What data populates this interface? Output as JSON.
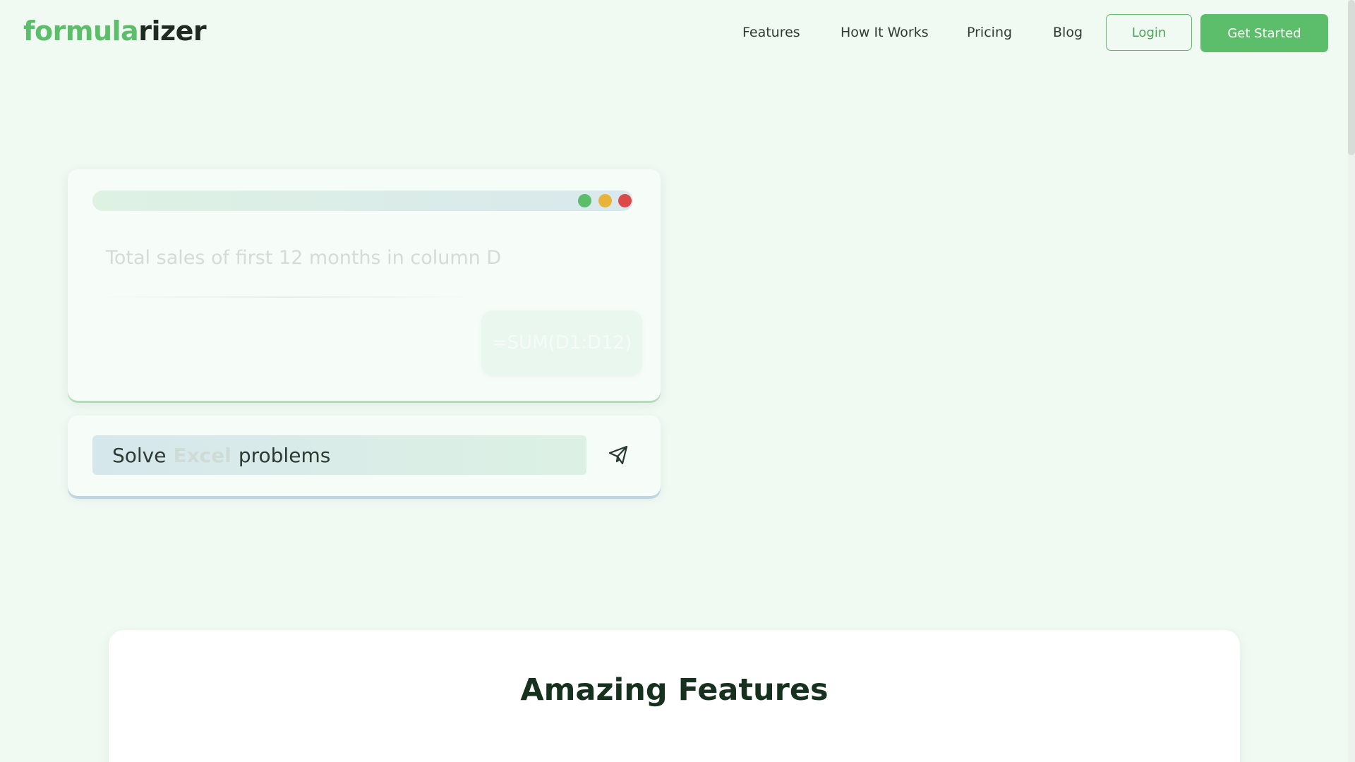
{
  "header": {
    "logo_part1": "formula",
    "logo_part2": "rizer",
    "nav": [
      "Features",
      "How It Works",
      "Pricing",
      "Blog"
    ],
    "login_label": "Login",
    "get_started_label": "Get Started"
  },
  "demo": {
    "prompt": "Total sales of first 12 months in column D",
    "formula": "=SUM(D1:D12)",
    "window_dot_colors": [
      "#5cbd6a",
      "#e9b33a",
      "#dc4a47"
    ]
  },
  "input": {
    "word1": "Solve",
    "word_highlight": "Excel",
    "word2": "problems"
  },
  "features": {
    "title": "Amazing Features"
  },
  "colors": {
    "brand_green": "#5cbd6a",
    "background": "#f0faf3",
    "dark_text": "#1f2a22"
  }
}
